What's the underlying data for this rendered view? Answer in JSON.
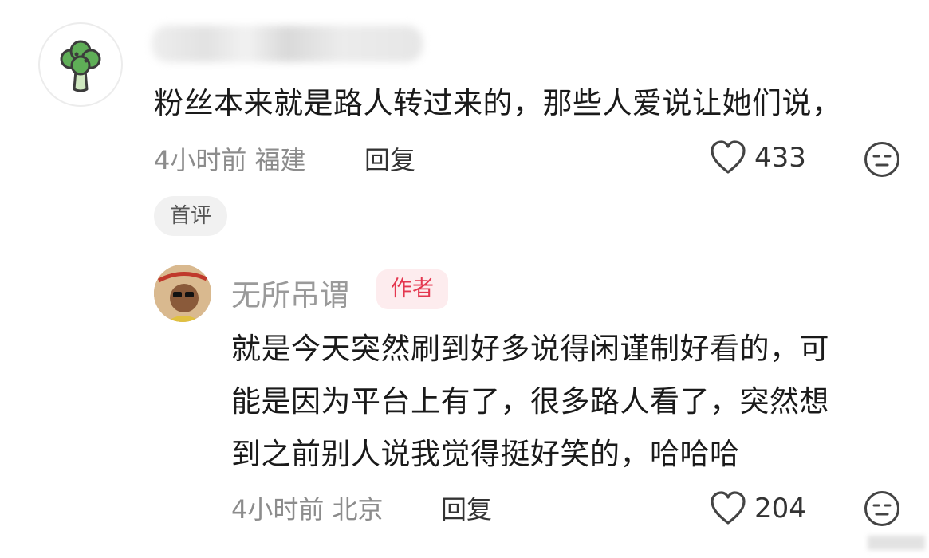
{
  "comments": [
    {
      "text": "粉丝本来就是路人转过来的，那些人爱说让她们说，",
      "meta": "4小时前 福建",
      "reply_label": "回复",
      "likes": "433",
      "tag": "首评",
      "avatar_icon": "broccoli-icon"
    }
  ],
  "reply": {
    "author_name": "无所吊谓",
    "author_badge": "作者",
    "lines": [
      "就是今天突然刷到好多说得闲谨制好看的，可",
      "能是因为平台上有了，很多路人看了，突然想",
      "到之前别人说我觉得挺好笑的，哈哈哈"
    ],
    "meta": "4小时前 北京",
    "reply_label": "回复",
    "likes": "204"
  },
  "colors": {
    "badge_text": "#e4374f",
    "badge_bg": "#fdecee",
    "meta_text": "#8c8c8c"
  }
}
